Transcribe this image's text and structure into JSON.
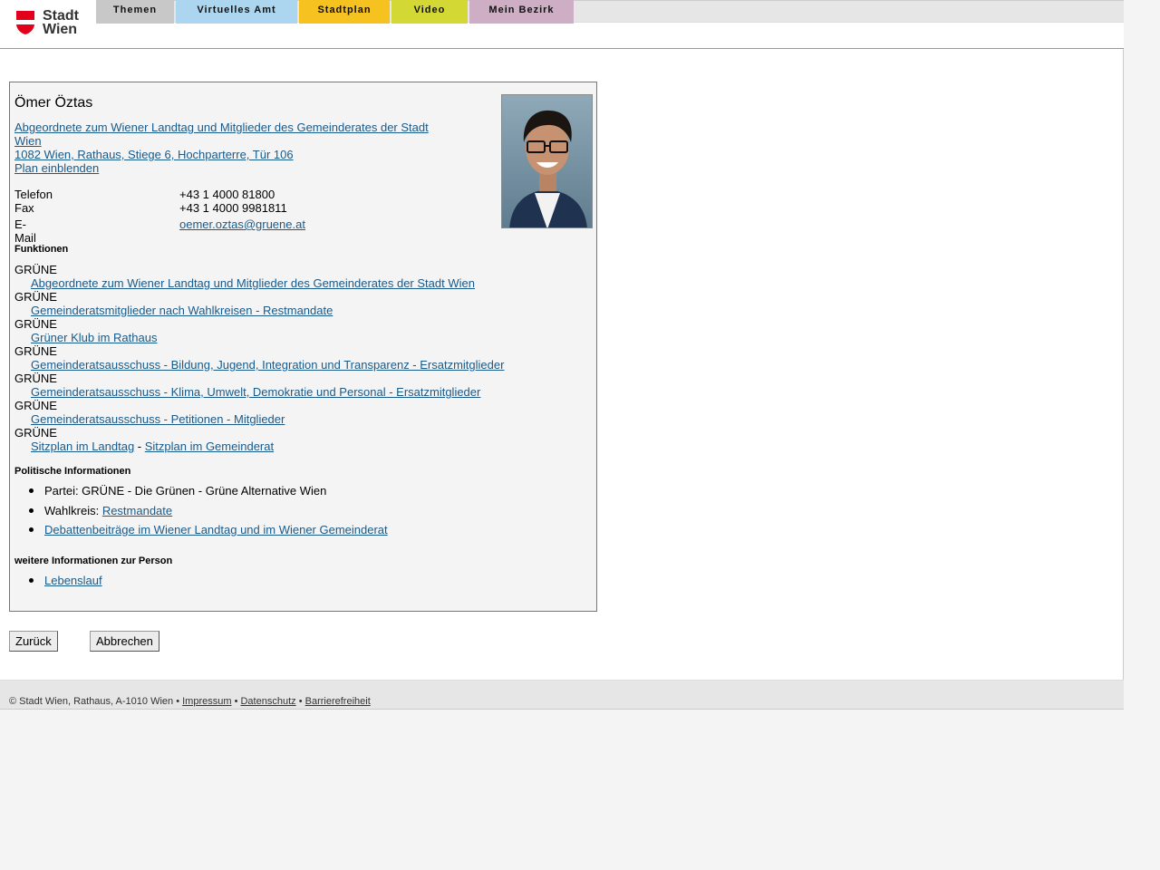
{
  "header": {
    "logo_text_1": "Stadt",
    "logo_text_2": "Wien",
    "tabs": [
      "Themen",
      "Virtuelles Amt",
      "Stadtplan",
      "Video",
      "Mein Bezirk"
    ]
  },
  "person": {
    "name": "Ömer Öztas",
    "position": "Abgeordnete zum Wiener Landtag und Mitglieder des Gemeinderates der Stadt Wien",
    "address": "1082 Wien, Rathaus, Stiege 6, Hochparterre, Tür 106",
    "plan_link": "Plan einblenden"
  },
  "contact": [
    {
      "label": "Telefon",
      "value": "+43 1 4000 81800"
    },
    {
      "label": "Fax",
      "value": "+43 1 4000 9981811"
    },
    {
      "label": "E-Mail",
      "value": "oemer.oztas@gruene.at"
    }
  ],
  "functions": {
    "heading": "Funktionen",
    "items": [
      {
        "party": "GRÜNE",
        "link": "Abgeordnete zum Wiener Landtag und Mitglieder des Gemeinderates der Stadt Wien"
      },
      {
        "party": "GRÜNE",
        "link": "Gemeinderatsmitglieder nach Wahlkreisen - Restmandate"
      },
      {
        "party": "GRÜNE",
        "link": "Grüner Klub im Rathaus"
      },
      {
        "party": "GRÜNE",
        "link": "Gemeinderatsausschuss - Bildung, Jugend, Integration und Transparenz - Ersatzmitglieder"
      },
      {
        "party": "GRÜNE",
        "link": "Gemeinderatsausschuss - Klima, Umwelt, Demokratie und Personal - Ersatzmitglieder"
      },
      {
        "party": "GRÜNE",
        "link": "Gemeinderatsausschuss - Petitionen - Mitglieder"
      },
      {
        "party": "GRÜNE",
        "link": "Sitzplan im Landtag",
        "separator": " - ",
        "link2": "Sitzplan im Gemeinderat"
      }
    ]
  },
  "political": {
    "heading": "Politische Informationen",
    "party": "Partei: GRÜNE - Die Grünen - Grüne Alternative Wien",
    "wahlkreis_label": "Wahlkreis: ",
    "wahlkreis_link": "Restmandate",
    "debate_link": "Debattenbeiträge im Wiener Landtag und im Wiener Gemeinderat"
  },
  "further": {
    "heading": "weitere Informationen zur Person",
    "cv_link": "Lebenslauf"
  },
  "buttons": {
    "back": "Zurück",
    "cancel": "Abbrechen"
  },
  "footer": {
    "copyright": "© Stadt Wien, Rathaus, A-1010 Wien",
    "sep": " • ",
    "impressum": "Impressum",
    "datenschutz": "Datenschutz",
    "barrierefreiheit": "Barrierefreiheit"
  },
  "colors": {
    "tab_themen": "#c8c8c8",
    "tab_virtuelles_amt": "#acd6ef",
    "tab_stadtplan": "#f6c21f",
    "tab_video": "#d4d834",
    "tab_mein_bezirk": "#cdaec5",
    "logo_red": "#e2001a",
    "link": "#1a5a8a"
  }
}
